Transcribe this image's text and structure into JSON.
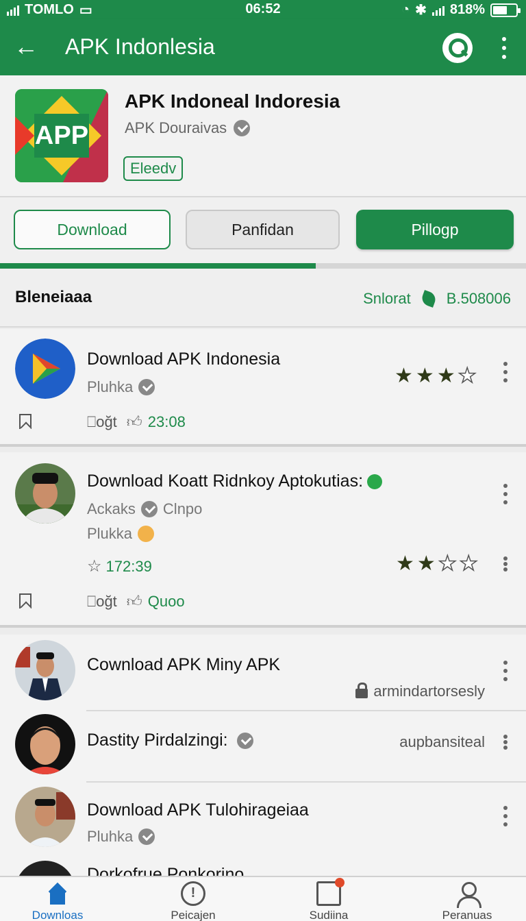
{
  "status_bar": {
    "carrier": "TOMLO",
    "time": "06:52",
    "battery": "818%"
  },
  "app_bar": {
    "title": "APK Indonlesia",
    "color": "#1e8a4a"
  },
  "app_header": {
    "icon_text": "APP",
    "name": "APK Indoneal Indoresia",
    "developer": "APK Douraivas",
    "chip": "Eleedv"
  },
  "actions": {
    "download": "Download",
    "panfidan": "Panfidan",
    "pillogp": "Pillogp",
    "progress_fraction": 0.6
  },
  "section": {
    "title": "Bleneiaaa",
    "right_label": "Snlorat",
    "right_value": "B.508006"
  },
  "items": [
    {
      "title": "Download APK Indonesia",
      "subtitle": "Pluhka",
      "rating": 3,
      "meta_left": "oğt",
      "meta_right": "23:08"
    },
    {
      "title": "Download Koatt Ridnkoy Aptokutias:",
      "line2_left": "Ackaks",
      "line2_right": "Clnpo",
      "line3": "Plukka",
      "time": "172:39",
      "rating": 2,
      "meta_left": "oğt",
      "meta_right": "Quoo"
    }
  ],
  "list": [
    {
      "title": "Cownload APK Miny APK",
      "right_text": "armindartorsesly"
    },
    {
      "title": "Dastity Pirdalzingi:",
      "right_text": "aupbansiteal"
    },
    {
      "title": "Download APK Tulohirageiaa",
      "subtitle": "Pluhka"
    },
    {
      "title": "Dorkofrue Ponkorino"
    }
  ],
  "bottom_nav": {
    "items": [
      {
        "label": "Downloas",
        "icon": "home-icon",
        "active": true
      },
      {
        "label": "Peicajen",
        "icon": "info-icon"
      },
      {
        "label": "Sudiina",
        "icon": "document-icon"
      },
      {
        "label": "Peranuas",
        "icon": "user-icon"
      }
    ],
    "active_color": "#1a6fc2"
  }
}
